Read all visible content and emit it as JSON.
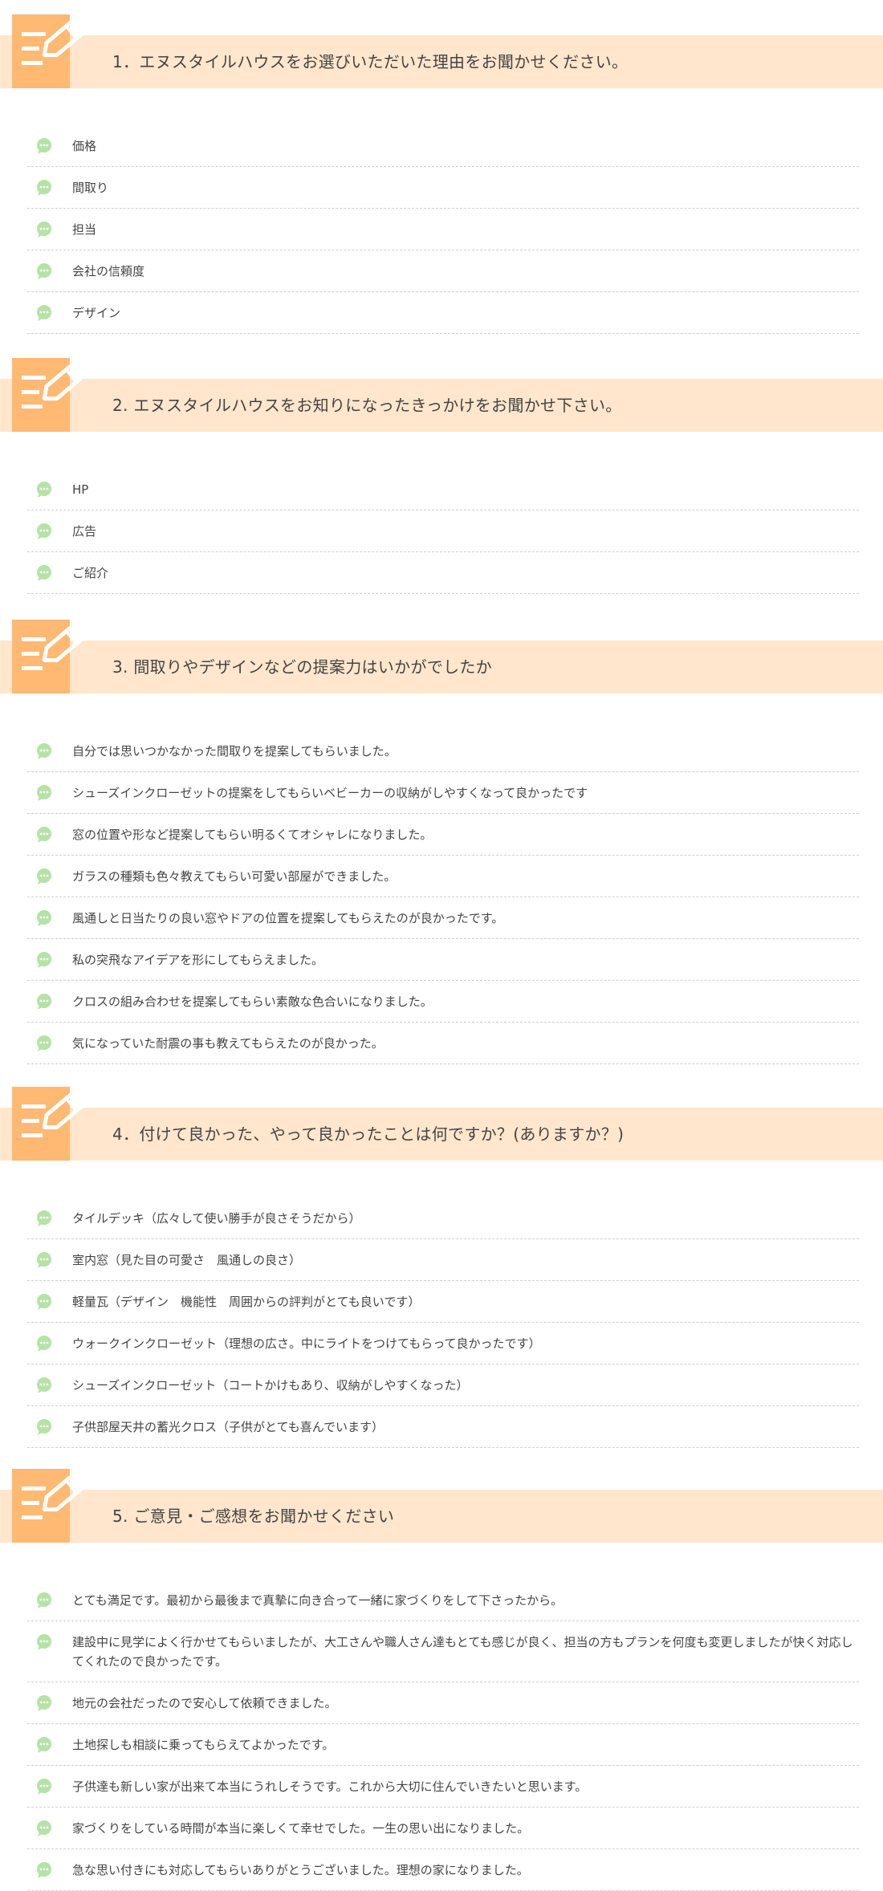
{
  "colors": {
    "header_band": "#ffe6cc",
    "header_icon": "#ffb973",
    "bubble": "#b4e3a6",
    "divider": "#cfcfcf",
    "text": "#444444"
  },
  "icons": {
    "question_icon": "memo-pencil-icon",
    "answer_icon": "speech-bubble-icon"
  },
  "sections": [
    {
      "title": "1．エヌスタイルハウスをお選びいただいた理由をお聞かせください。",
      "answers": [
        "価格",
        "間取り",
        "担当",
        "会社の信頼度",
        "デザイン"
      ]
    },
    {
      "title": "2. エヌスタイルハウスをお知りになったきっかけをお聞かせ下さい。",
      "answers": [
        "HP",
        "広告",
        "ご紹介"
      ]
    },
    {
      "title": "3. 間取りやデザインなどの提案力はいかがでしたか",
      "answers": [
        "自分では思いつかなかった間取りを提案してもらいました。",
        "シューズインクローゼットの提案をしてもらいベビーカーの収納がしやすくなって良かったです",
        "窓の位置や形など提案してもらい明るくてオシャレになりました。",
        "ガラスの種類も色々教えてもらい可愛い部屋ができました。",
        "風通しと日当たりの良い窓やドアの位置を提案してもらえたのが良かったです。",
        "私の突飛なアイデアを形にしてもらえました。",
        "クロスの組み合わせを提案してもらい素敵な色合いになりました。",
        "気になっていた耐震の事も教えてもらえたのが良かった。"
      ]
    },
    {
      "title": "4．付けて良かった、やって良かったことは何ですか？(ありますか？)",
      "answers": [
        "タイルデッキ（広々して使い勝手が良さそうだから）",
        "室内窓（見た目の可愛さ　風通しの良さ）",
        "軽量瓦（デザイン　機能性　周囲からの評判がとても良いです）",
        "ウォークインクローゼット（理想の広さ。中にライトをつけてもらって良かったです）",
        "シューズインクローゼット（コートかけもあり、収納がしやすくなった）",
        "子供部屋天井の蓄光クロス（子供がとても喜んでいます）"
      ]
    },
    {
      "title": "5. ご意見・ご感想をお聞かせください",
      "answers": [
        "とても満足です。最初から最後まで真摯に向き合って一緒に家づくりをして下さったから。",
        "建設中に見学によく行かせてもらいましたが、大工さんや職人さん達もとても感じが良く、担当の方もプランを何度も変更しましたが快く対応してくれたので良かったです。",
        "地元の会社だったので安心して依頼できました。",
        "土地探しも相談に乗ってもらえてよかったです。",
        "子供達も新しい家が出来て本当にうれしそうです。これから大切に住んでいきたいと思います。",
        "家づくりをしている時間が本当に楽しくて幸せでした。一生の思い出になりました。",
        "急な思い付きにも対応してもらいありがとうございました。理想の家になりました。"
      ]
    }
  ]
}
